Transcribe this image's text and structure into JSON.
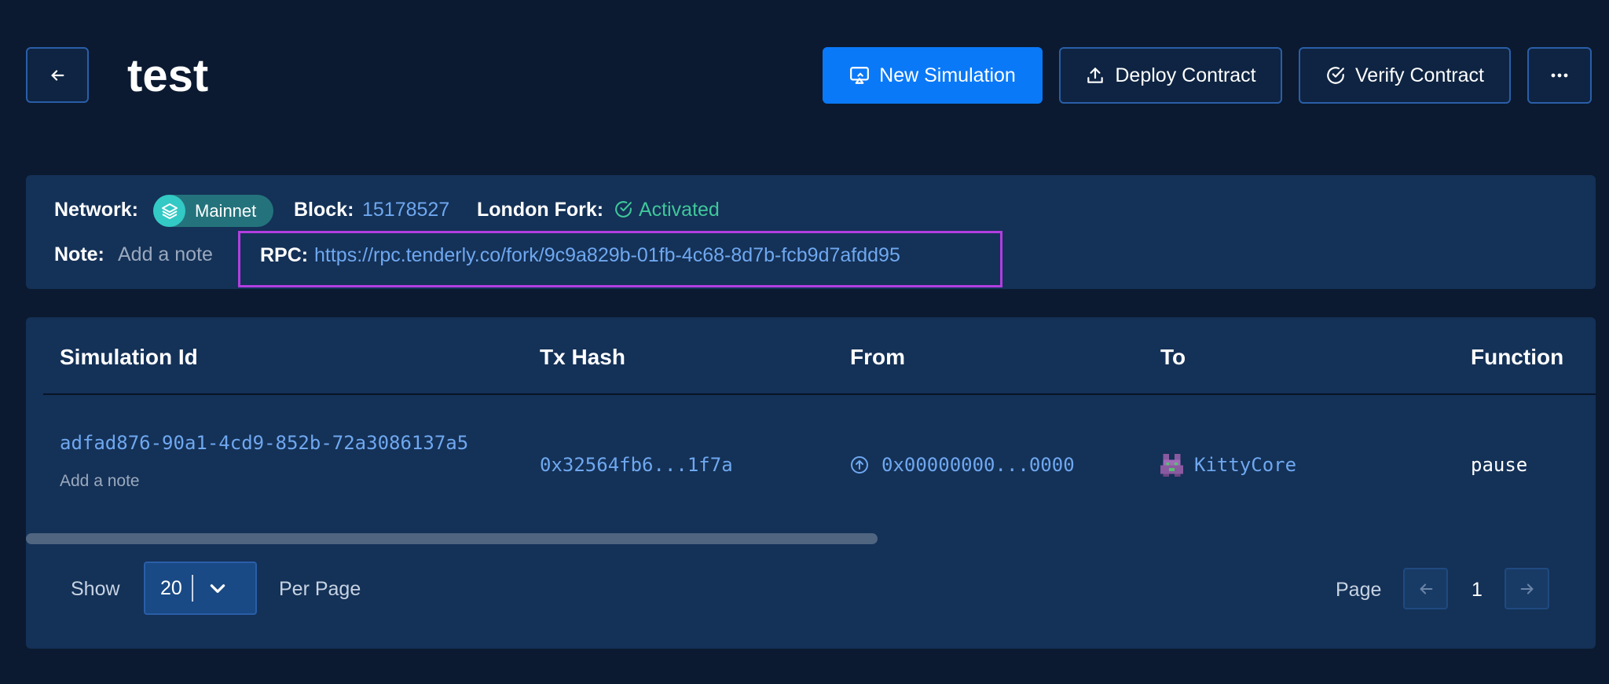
{
  "header": {
    "title": "test",
    "new_simulation_label": "New Simulation",
    "deploy_contract_label": "Deploy Contract",
    "verify_contract_label": "Verify Contract",
    "more_label": "···"
  },
  "info": {
    "network_label": "Network:",
    "network_value": "Mainnet",
    "block_label": "Block:",
    "block_value": "15178527",
    "london_fork_label": "London Fork:",
    "london_fork_value": "Activated",
    "note_label": "Note:",
    "note_placeholder": "Add a note",
    "rpc_label": "RPC:",
    "rpc_url": "https://rpc.tenderly.co/fork/9c9a829b-01fb-4c68-8d7b-fcb9d7afdd95"
  },
  "table": {
    "columns": [
      "Simulation Id",
      "Tx Hash",
      "From",
      "To",
      "Function"
    ],
    "rows": [
      {
        "simulation_id": "adfad876-90a1-4cd9-852b-72a3086137a5",
        "note": "Add a note",
        "tx_hash": "0x32564fb6...1f7a",
        "from": "0x00000000...0000",
        "to": "KittyCore",
        "function": "pause"
      }
    ]
  },
  "pagination": {
    "show_label": "Show",
    "per_page_value": "20",
    "per_page_label": "Per Page",
    "page_label": "Page",
    "page_number": "1"
  },
  "colors": {
    "background": "#0b1a30",
    "panel": "#143157",
    "primary": "#0a79f7",
    "link": "#6fa8f0",
    "activated": "#3fc79a",
    "highlight_box": "#b23ee0"
  },
  "icons": {
    "back": "arrow-left-icon",
    "new_simulation": "monitor-play-icon",
    "deploy": "upload-icon",
    "verify": "check-circle-icon",
    "more": "ellipsis-icon",
    "network": "layers-icon",
    "activated": "check-circle-icon",
    "from": "arrow-up-circle-icon",
    "to": "kitty-avatar-icon",
    "per_page": "chevron-down-icon",
    "prev_page": "arrow-left-icon",
    "next_page": "arrow-right-icon"
  }
}
